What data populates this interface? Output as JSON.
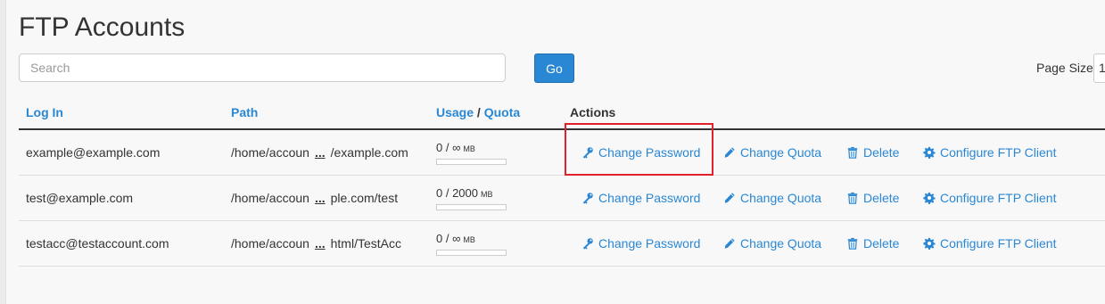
{
  "page": {
    "title": "FTP Accounts"
  },
  "search": {
    "placeholder": "Search",
    "value": ""
  },
  "go_button": {
    "label": "Go"
  },
  "page_size": {
    "label": "Page Size",
    "value": "1"
  },
  "table": {
    "headers": {
      "login": "Log In",
      "path": "Path",
      "usage": "Usage",
      "separator": "/",
      "quota": "Quota",
      "actions": "Actions"
    },
    "rows": [
      {
        "login": "example@example.com",
        "path_start": "/home/accoun",
        "path_ellipsis": "...",
        "path_end": "/example.com",
        "usage": "0 / ∞",
        "unit": "MB",
        "usage_fraction": 0
      },
      {
        "login": "test@example.com",
        "path_start": "/home/accoun",
        "path_ellipsis": "...",
        "path_end": "ple.com/test",
        "usage": "0 / 2000",
        "unit": "MB",
        "usage_fraction": 0
      },
      {
        "login": "testacc@testaccount.com",
        "path_start": "/home/accoun",
        "path_ellipsis": "...",
        "path_end": "html/TestAcc",
        "usage": "0 / ∞",
        "unit": "MB",
        "usage_fraction": 0
      }
    ],
    "actions": {
      "change_password": "Change Password",
      "change_quota": "Change Quota",
      "delete": "Delete",
      "configure": "Configure FTP Client"
    }
  },
  "icons": {
    "change_password": "key-icon",
    "change_quota": "pencil-icon",
    "delete": "trash-icon",
    "configure": "gear-icon"
  },
  "colors": {
    "link": "#2a87d4",
    "button": "#2a87d4",
    "highlight": "#e0202a"
  }
}
